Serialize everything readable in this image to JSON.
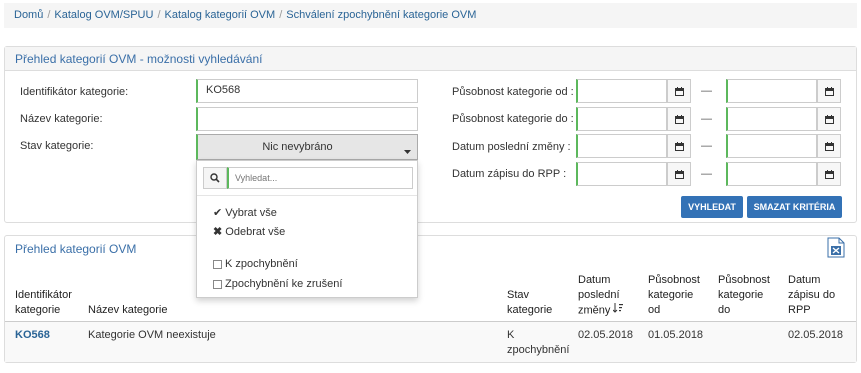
{
  "breadcrumb": {
    "items": [
      "Domů",
      "Katalog OVM/SPUU",
      "Katalog kategorií OVM",
      "Schválení zpochybnění kategorie OVM"
    ],
    "separator": "/"
  },
  "search_panel": {
    "title": "Přehled kategorií OVM - možnosti vyhledávání",
    "id_label": "Identifikátor kategorie:",
    "id_value": "KO568",
    "name_label": "Název kategorie:",
    "name_value": "",
    "state_label": "Stav kategorie:",
    "state_selected": "Nic nevybráno",
    "valid_from_label": "Působnost kategorie od :",
    "valid_to_label": "Působnost kategorie do :",
    "last_change_label": "Datum poslední změny :",
    "rpp_label": "Datum zápisu do RPP :",
    "range_dash": "—",
    "search_button": "VYHLEDAT",
    "clear_button": "SMAZAT KRITÉRIA"
  },
  "state_dropdown": {
    "search_placeholder": "Vyhledat...",
    "select_all": "Vybrat vše",
    "deselect_all": "Odebrat vše",
    "options": [
      "K zpochybnění",
      "Zpochybnění ke zrušení"
    ]
  },
  "results_panel": {
    "title": "Přehled kategorií OVM",
    "headers": {
      "id": "Identifikátor kategorie",
      "name": "Název kategorie",
      "state": "Stav kategorie",
      "last_change": "Datum poslední změny",
      "valid_from": "Působnost kategorie od",
      "valid_to": "Působnost kategorie do",
      "rpp": "Datum zápisu do RPP"
    },
    "rows": [
      {
        "id": "KO568",
        "name": "Kategorie OVM neexistuje",
        "state": "K zpochybnění",
        "last_change": "02.05.2018",
        "valid_from": "01.05.2018",
        "valid_to": "",
        "rpp": "02.05.2018"
      }
    ]
  },
  "colors": {
    "accent": "#3372b6",
    "link": "#2a6496",
    "valid_border": "#5cb85c"
  }
}
